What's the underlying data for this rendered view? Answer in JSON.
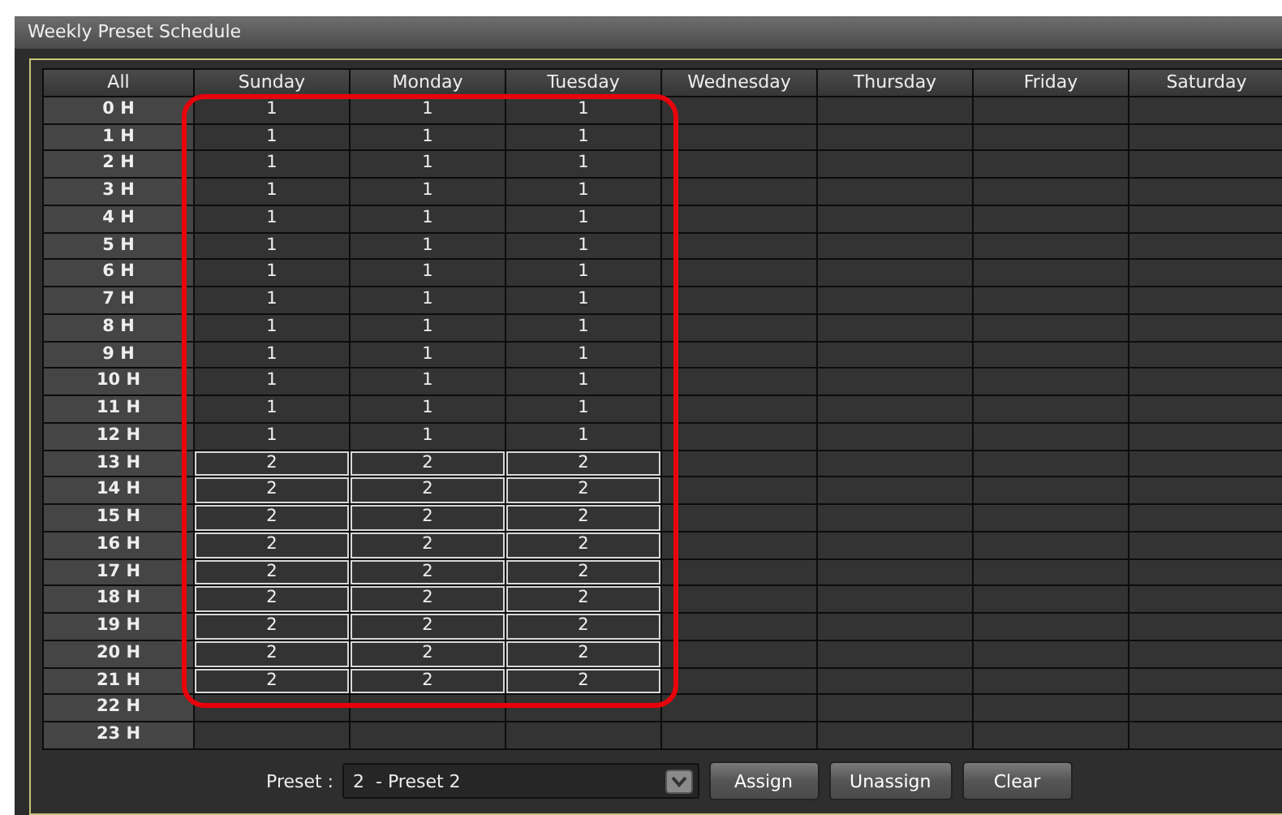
{
  "window": {
    "title": "Weekly Preset Schedule"
  },
  "grid": {
    "corner": "All",
    "columns": [
      "Sunday",
      "Monday",
      "Tuesday",
      "Wednesday",
      "Thursday",
      "Friday",
      "Saturday"
    ],
    "rows": [
      {
        "label": "0 H",
        "cells": [
          {
            "value": "1",
            "selected": false
          },
          {
            "value": "1",
            "selected": false
          },
          {
            "value": "1",
            "selected": false
          },
          null,
          null,
          null,
          null
        ]
      },
      {
        "label": "1 H",
        "cells": [
          {
            "value": "1",
            "selected": false
          },
          {
            "value": "1",
            "selected": false
          },
          {
            "value": "1",
            "selected": false
          },
          null,
          null,
          null,
          null
        ]
      },
      {
        "label": "2 H",
        "cells": [
          {
            "value": "1",
            "selected": false
          },
          {
            "value": "1",
            "selected": false
          },
          {
            "value": "1",
            "selected": false
          },
          null,
          null,
          null,
          null
        ]
      },
      {
        "label": "3 H",
        "cells": [
          {
            "value": "1",
            "selected": false
          },
          {
            "value": "1",
            "selected": false
          },
          {
            "value": "1",
            "selected": false
          },
          null,
          null,
          null,
          null
        ]
      },
      {
        "label": "4 H",
        "cells": [
          {
            "value": "1",
            "selected": false
          },
          {
            "value": "1",
            "selected": false
          },
          {
            "value": "1",
            "selected": false
          },
          null,
          null,
          null,
          null
        ]
      },
      {
        "label": "5 H",
        "cells": [
          {
            "value": "1",
            "selected": false
          },
          {
            "value": "1",
            "selected": false
          },
          {
            "value": "1",
            "selected": false
          },
          null,
          null,
          null,
          null
        ]
      },
      {
        "label": "6 H",
        "cells": [
          {
            "value": "1",
            "selected": false
          },
          {
            "value": "1",
            "selected": false
          },
          {
            "value": "1",
            "selected": false
          },
          null,
          null,
          null,
          null
        ]
      },
      {
        "label": "7 H",
        "cells": [
          {
            "value": "1",
            "selected": false
          },
          {
            "value": "1",
            "selected": false
          },
          {
            "value": "1",
            "selected": false
          },
          null,
          null,
          null,
          null
        ]
      },
      {
        "label": "8 H",
        "cells": [
          {
            "value": "1",
            "selected": false
          },
          {
            "value": "1",
            "selected": false
          },
          {
            "value": "1",
            "selected": false
          },
          null,
          null,
          null,
          null
        ]
      },
      {
        "label": "9 H",
        "cells": [
          {
            "value": "1",
            "selected": false
          },
          {
            "value": "1",
            "selected": false
          },
          {
            "value": "1",
            "selected": false
          },
          null,
          null,
          null,
          null
        ]
      },
      {
        "label": "10 H",
        "cells": [
          {
            "value": "1",
            "selected": false
          },
          {
            "value": "1",
            "selected": false
          },
          {
            "value": "1",
            "selected": false
          },
          null,
          null,
          null,
          null
        ]
      },
      {
        "label": "11 H",
        "cells": [
          {
            "value": "1",
            "selected": false
          },
          {
            "value": "1",
            "selected": false
          },
          {
            "value": "1",
            "selected": false
          },
          null,
          null,
          null,
          null
        ]
      },
      {
        "label": "12 H",
        "cells": [
          {
            "value": "1",
            "selected": false
          },
          {
            "value": "1",
            "selected": false
          },
          {
            "value": "1",
            "selected": false
          },
          null,
          null,
          null,
          null
        ]
      },
      {
        "label": "13 H",
        "cells": [
          {
            "value": "2",
            "selected": true
          },
          {
            "value": "2",
            "selected": true
          },
          {
            "value": "2",
            "selected": true
          },
          null,
          null,
          null,
          null
        ]
      },
      {
        "label": "14 H",
        "cells": [
          {
            "value": "2",
            "selected": true
          },
          {
            "value": "2",
            "selected": true
          },
          {
            "value": "2",
            "selected": true
          },
          null,
          null,
          null,
          null
        ]
      },
      {
        "label": "15 H",
        "cells": [
          {
            "value": "2",
            "selected": true
          },
          {
            "value": "2",
            "selected": true
          },
          {
            "value": "2",
            "selected": true
          },
          null,
          null,
          null,
          null
        ]
      },
      {
        "label": "16 H",
        "cells": [
          {
            "value": "2",
            "selected": true
          },
          {
            "value": "2",
            "selected": true
          },
          {
            "value": "2",
            "selected": true
          },
          null,
          null,
          null,
          null
        ]
      },
      {
        "label": "17 H",
        "cells": [
          {
            "value": "2",
            "selected": true
          },
          {
            "value": "2",
            "selected": true
          },
          {
            "value": "2",
            "selected": true
          },
          null,
          null,
          null,
          null
        ]
      },
      {
        "label": "18 H",
        "cells": [
          {
            "value": "2",
            "selected": true
          },
          {
            "value": "2",
            "selected": true
          },
          {
            "value": "2",
            "selected": true
          },
          null,
          null,
          null,
          null
        ]
      },
      {
        "label": "19 H",
        "cells": [
          {
            "value": "2",
            "selected": true
          },
          {
            "value": "2",
            "selected": true
          },
          {
            "value": "2",
            "selected": true
          },
          null,
          null,
          null,
          null
        ]
      },
      {
        "label": "20 H",
        "cells": [
          {
            "value": "2",
            "selected": true
          },
          {
            "value": "2",
            "selected": true
          },
          {
            "value": "2",
            "selected": true
          },
          null,
          null,
          null,
          null
        ]
      },
      {
        "label": "21 H",
        "cells": [
          {
            "value": "2",
            "selected": true
          },
          {
            "value": "2",
            "selected": true
          },
          {
            "value": "2",
            "selected": true
          },
          null,
          null,
          null,
          null
        ]
      },
      {
        "label": "22 H",
        "cells": [
          null,
          null,
          null,
          null,
          null,
          null,
          null
        ]
      },
      {
        "label": "23 H",
        "cells": [
          null,
          null,
          null,
          null,
          null,
          null,
          null
        ]
      }
    ]
  },
  "footer": {
    "preset_label": "Preset :",
    "preset_value": "2  - Preset 2",
    "buttons": [
      "Assign",
      "Unassign",
      "Clear"
    ]
  }
}
